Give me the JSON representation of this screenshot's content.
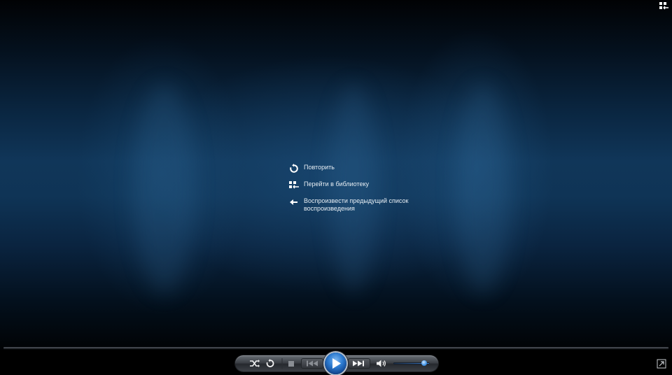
{
  "window": {
    "background_color": "#0f3456",
    "accent_color": "#2d7bd0"
  },
  "top_right": {
    "switch_to_library_icon": "switch-to-library-icon"
  },
  "menu": {
    "items": [
      {
        "label": "Повторить",
        "icon": "replay-icon"
      },
      {
        "label": "Перейти в библиотеку",
        "icon": "library-icon"
      },
      {
        "label": "Воспроизвести предыдущий список воспроизведения",
        "icon": "back-arrow-icon"
      }
    ]
  },
  "seek": {
    "progress": 0
  },
  "controls": {
    "shuffle_icon": "shuffle-icon",
    "repeat_icon": "repeat-icon",
    "stop_icon": "stop-icon",
    "previous_icon": "previous-icon",
    "play_icon": "play-icon",
    "next_icon": "next-icon",
    "mute_icon": "speaker-icon",
    "volume_level": 0.85
  },
  "bottom_right": {
    "fullscreen_icon": "fullscreen-icon"
  }
}
